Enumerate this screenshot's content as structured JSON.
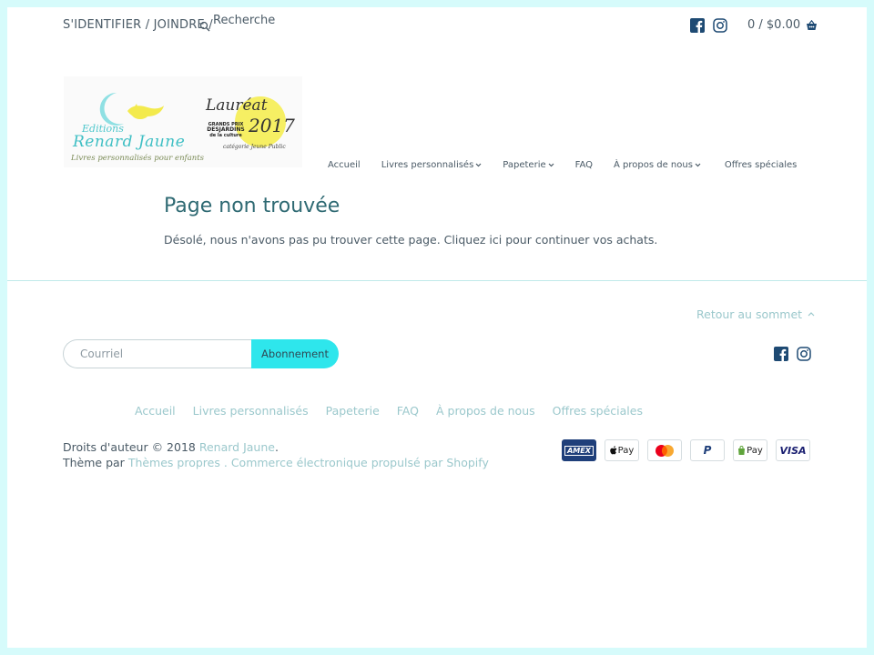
{
  "header": {
    "login_label": "S'IDENTIFIER",
    "separator": "/",
    "join_label": "JOINDRE",
    "search_placeholder": "Recherche",
    "cart_text": "0 / $0.00"
  },
  "logo": {
    "editions": "Editions",
    "name": "Renard Jaune",
    "tagline": "Livres personnalisés pour enfants",
    "laureat": "Lauréat",
    "year": "2017",
    "award_line1": "GRANDS PRIX",
    "award_line2": "DESJARDINS",
    "award_line3": "de la culture",
    "category": "catégorie Jeune Public"
  },
  "nav": {
    "items": [
      {
        "label": "Accueil",
        "dropdown": false
      },
      {
        "label": "Livres personnalisés",
        "dropdown": true
      },
      {
        "label": "Papeterie",
        "dropdown": true
      },
      {
        "label": "FAQ",
        "dropdown": false
      },
      {
        "label": "À propos de nous",
        "dropdown": true
      },
      {
        "label": "Offres spéciales",
        "dropdown": false
      }
    ]
  },
  "main": {
    "title": "Page non trouvée",
    "message": "Désolé, nous n'avons pas pu trouver cette page. Cliquez ici pour continuer vos achats."
  },
  "footer": {
    "back_to_top": "Retour au sommet",
    "email_placeholder": "Courriel",
    "subscribe_label": "Abonnement",
    "nav": [
      "Accueil",
      "Livres personnalisés",
      "Papeterie",
      "FAQ",
      "À propos de nous",
      "Offres spéciales"
    ],
    "copyright_prefix": "Droits d'auteur © 2018",
    "copyright_brand": "Renard Jaune",
    "copyright_suffix": ".",
    "theme_prefix": "Thème par",
    "theme_link": "Thèmes propres",
    "theme_sep": ".",
    "shopify_link": "Commerce électronique propulsé par Shopify",
    "payments": [
      "AMEX",
      "Pay",
      "",
      "P",
      "Pay",
      "VISA"
    ]
  },
  "colors": {
    "accent": "#2ee6ec",
    "title": "#2f6a73",
    "link_muted": "#9bc8cc",
    "page_bg": "#d6fbfb"
  },
  "icons": {
    "search": "search-icon",
    "facebook": "facebook-icon",
    "instagram": "instagram-icon",
    "cart": "cart-icon"
  }
}
